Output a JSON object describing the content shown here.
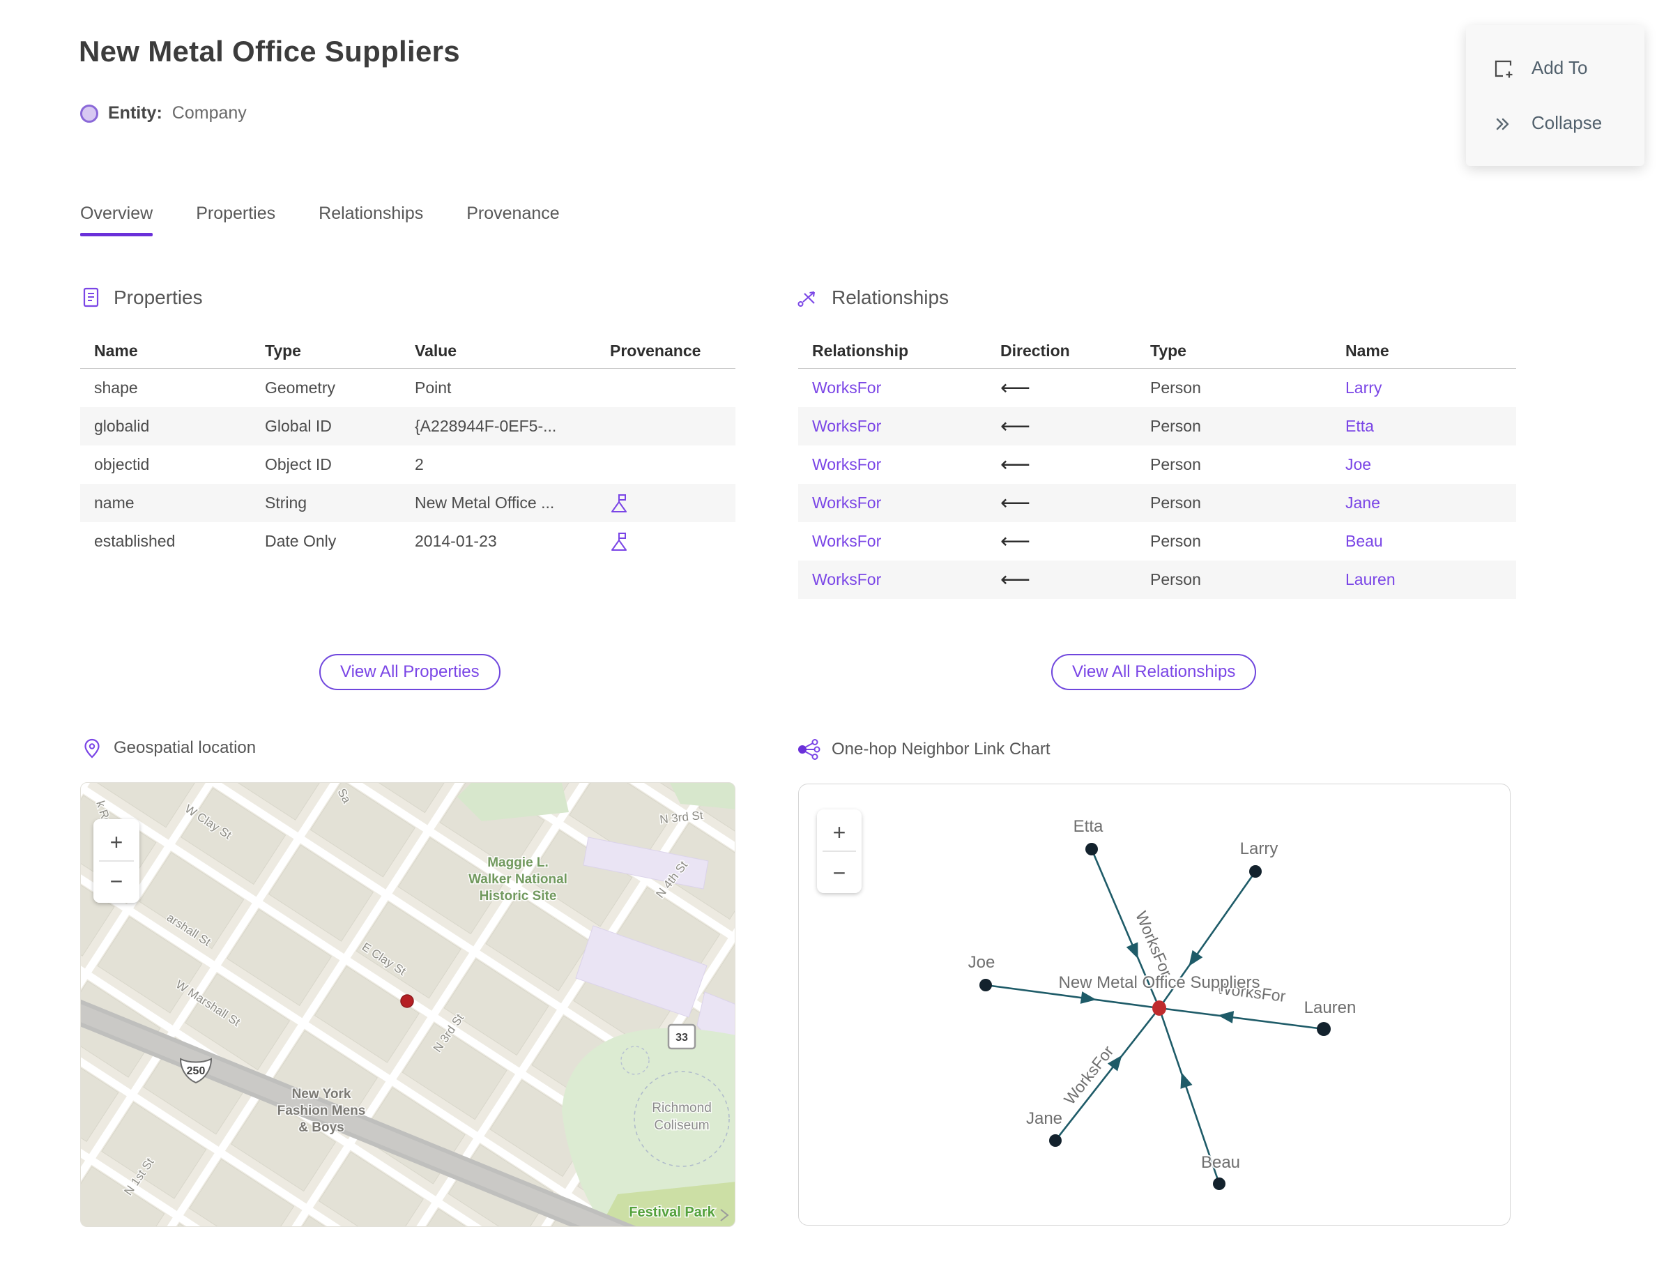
{
  "page": {
    "title": "New Metal Office Suppliers",
    "entity_label": "Entity:",
    "entity_type": "Company"
  },
  "menu": {
    "add_to": "Add To",
    "collapse": "Collapse"
  },
  "tabs": {
    "overview": "Overview",
    "properties": "Properties",
    "relationships": "Relationships",
    "provenance": "Provenance"
  },
  "properties": {
    "title": "Properties",
    "columns": {
      "name": "Name",
      "type": "Type",
      "value": "Value",
      "provenance": "Provenance"
    },
    "rows": [
      {
        "name": "shape",
        "type": "Geometry",
        "value": "Point"
      },
      {
        "name": "globalid",
        "type": "Global ID",
        "value": "{A228944F-0EF5-..."
      },
      {
        "name": "objectid",
        "type": "Object ID",
        "value": "2"
      },
      {
        "name": "name",
        "type": "String",
        "value": "New Metal Office ..."
      },
      {
        "name": "established",
        "type": "Date Only",
        "value": "2014-01-23"
      }
    ],
    "view_all": "View All Properties"
  },
  "relationships": {
    "title": "Relationships",
    "columns": {
      "relationship": "Relationship",
      "direction": "Direction",
      "type": "Type",
      "name": "Name"
    },
    "rows": [
      {
        "relationship": "WorksFor",
        "direction": "⟵",
        "type": "Person",
        "name": "Larry"
      },
      {
        "relationship": "WorksFor",
        "direction": "⟵",
        "type": "Person",
        "name": "Etta"
      },
      {
        "relationship": "WorksFor",
        "direction": "⟵",
        "type": "Person",
        "name": "Joe"
      },
      {
        "relationship": "WorksFor",
        "direction": "⟵",
        "type": "Person",
        "name": "Jane"
      },
      {
        "relationship": "WorksFor",
        "direction": "⟵",
        "type": "Person",
        "name": "Beau"
      },
      {
        "relationship": "WorksFor",
        "direction": "⟵",
        "type": "Person",
        "name": "Lauren"
      }
    ],
    "view_all": "View All Relationships"
  },
  "map": {
    "title": "Geospatial location",
    "zoom_in": "+",
    "zoom_out": "−",
    "streets": {
      "k_rd": "k Rd",
      "w_clay": "W Clay St",
      "sa": "Sa",
      "n3rd_top": "N 3rd St",
      "n4th": "N 4th St",
      "e_clay": "E Clay St",
      "marshall": "arshall St",
      "w_marshall": "W Marshall St",
      "n1st": "N 1st St",
      "n3rd_low": "N 3rd St"
    },
    "places": {
      "maggie1": "Maggie L.",
      "maggie2": "Walker National",
      "maggie3": "Historic Site",
      "ny1": "New York",
      "ny2": "Fashion Mens",
      "ny3": "& Boys",
      "col1": "Richmond",
      "col2": "Coliseum",
      "festival": "Festival Park"
    },
    "shields": {
      "s250": "250",
      "s33": "33"
    }
  },
  "linkchart": {
    "title": "One-hop Neighbor Link Chart",
    "zoom_in": "+",
    "zoom_out": "−",
    "center": "New Metal Office Suppliers",
    "edge_label": "WorksFor",
    "nodes": {
      "etta": "Etta",
      "larry": "Larry",
      "joe": "Joe",
      "lauren": "Lauren",
      "jane": "Jane",
      "beau": "Beau"
    },
    "edges": [
      {
        "from": "Larry",
        "to": "New Metal Office Suppliers",
        "label": "WorksFor"
      },
      {
        "from": "Etta",
        "to": "New Metal Office Suppliers",
        "label": "WorksFor"
      },
      {
        "from": "Joe",
        "to": "New Metal Office Suppliers",
        "label": "WorksFor"
      },
      {
        "from": "Jane",
        "to": "New Metal Office Suppliers",
        "label": "WorksFor"
      },
      {
        "from": "Beau",
        "to": "New Metal Office Suppliers",
        "label": "WorksFor"
      },
      {
        "from": "Lauren",
        "to": "New Metal Office Suppliers",
        "label": "WorksFor"
      }
    ]
  },
  "colors": {
    "accent": "#7a45e6",
    "edge": "#1e5b68",
    "node": "#13222d",
    "center_node": "#bf2b2d",
    "marker": "#b51f24"
  }
}
